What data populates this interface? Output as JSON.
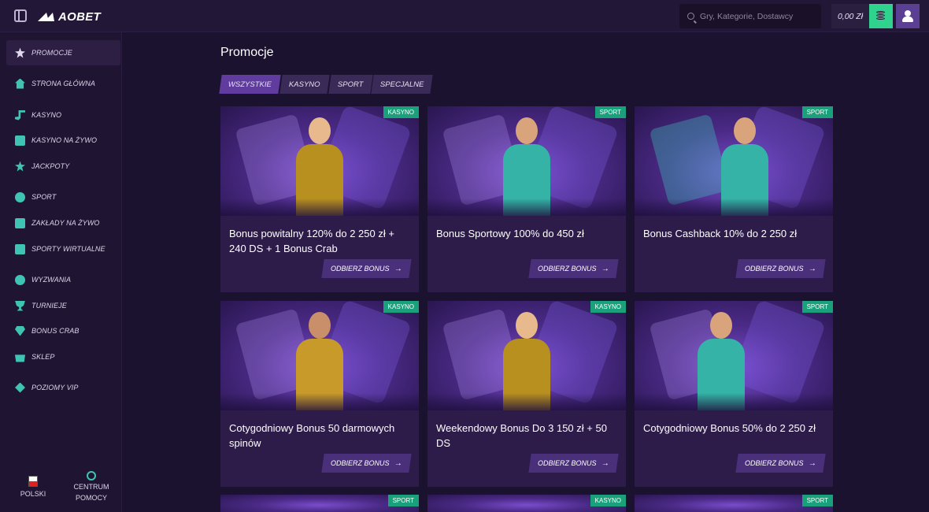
{
  "brand": {
    "name": "AOBET"
  },
  "search": {
    "placeholder": "Gry, Kategorie, Dostawcy"
  },
  "header": {
    "balance": "0,00 Zł"
  },
  "sidebar": {
    "items": [
      {
        "label": "PROMOCJE",
        "icon": "gift-icon"
      },
      {
        "label": "STRONA GŁÓWNA",
        "icon": "home-icon"
      },
      {
        "label": "KASYNO",
        "icon": "music-note-icon"
      },
      {
        "label": "KASYNO NA ŻYWO",
        "icon": "live-casino-icon"
      },
      {
        "label": "JACKPOTY",
        "icon": "clover-icon"
      },
      {
        "label": "SPORT",
        "icon": "sport-icon"
      },
      {
        "label": "ZAKŁADY NA ŻYWO",
        "icon": "live-bets-icon"
      },
      {
        "label": "SPORTY WIRTUALNE",
        "icon": "virtual-sports-icon"
      },
      {
        "label": "WYZWANIA",
        "icon": "challenge-icon"
      },
      {
        "label": "TURNIEJE",
        "icon": "trophy-icon"
      },
      {
        "label": "BONUS CRAB",
        "icon": "crab-icon"
      },
      {
        "label": "SKLEP",
        "icon": "shop-bag-icon"
      },
      {
        "label": "POZIOMY VIP",
        "icon": "diamond-icon"
      }
    ],
    "language": "POLSKI",
    "help": [
      "CENTRUM",
      "POMOCY"
    ]
  },
  "main": {
    "title": "Promocje",
    "tabs": [
      "WSZYSTKIE",
      "KASYNO",
      "SPORT",
      "SPECJALNE"
    ],
    "claim_label": "ODBIERZ BONUS",
    "cards": [
      {
        "badge": "KASYNO",
        "title": "Bonus powitalny 120% do 2 250 zł + 240 DS + 1 Bonus Crab"
      },
      {
        "badge": "SPORT",
        "title": "Bonus Sportowy 100% do 450 zł"
      },
      {
        "badge": "SPORT",
        "title": "Bonus Cashback 10% do 2 250 zł"
      },
      {
        "badge": "KASYNO",
        "title": "Cotygodniowy Bonus 50 darmowych spinów"
      },
      {
        "badge": "KASYNO",
        "title": "Weekendowy Bonus Do 3 150 zł + 50 DS"
      },
      {
        "badge": "SPORT",
        "title": "Cotygodniowy Bonus 50% do 2 250 zł"
      },
      {
        "badge": "SPORT",
        "title": ""
      },
      {
        "badge": "KASYNO",
        "title": ""
      },
      {
        "badge": "SPORT",
        "title": ""
      }
    ]
  },
  "colors": {
    "accent_green": "#2fd38e",
    "accent_purple": "#5b3f92",
    "badge_green": "#1aa07a",
    "teal_icon": "#3fc4b4",
    "bg": "#1b1230"
  }
}
